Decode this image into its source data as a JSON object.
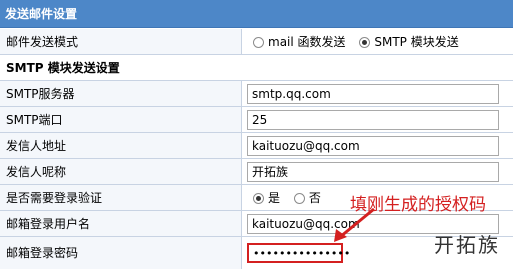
{
  "header": {
    "title": "发送邮件设置"
  },
  "send_mode": {
    "label": "邮件发送模式",
    "options": [
      {
        "label": "mail 函数发送",
        "selected": false
      },
      {
        "label": "SMTP 模块发送",
        "selected": true
      }
    ]
  },
  "smtp_section": {
    "title": "SMTP 模块发送设置"
  },
  "fields": {
    "server": {
      "label": "SMTP服务器",
      "value": "smtp.qq.com"
    },
    "port": {
      "label": "SMTP端口",
      "value": "25"
    },
    "from_address": {
      "label": "发信人地址",
      "value": "kaituozu@qq.com"
    },
    "sender_name": {
      "label": "发信人呢称",
      "value": "开拓族"
    },
    "auth": {
      "label": "是否需要登录验证",
      "options": [
        {
          "label": "是",
          "selected": true
        },
        {
          "label": "否",
          "selected": false
        }
      ]
    },
    "username": {
      "label": "邮箱登录用户名",
      "value": "kaituozu@qq.com"
    },
    "password": {
      "label": "邮箱登录密码",
      "value": "•••••••••••••••"
    }
  },
  "annotation": {
    "text": "填刚生成的授权码",
    "color": "#d42020"
  },
  "watermark": {
    "text": "开拓族"
  },
  "colors": {
    "header_bg": "#4d87c8",
    "label_bg": "#f4f7fb",
    "highlight": "#d42020"
  }
}
